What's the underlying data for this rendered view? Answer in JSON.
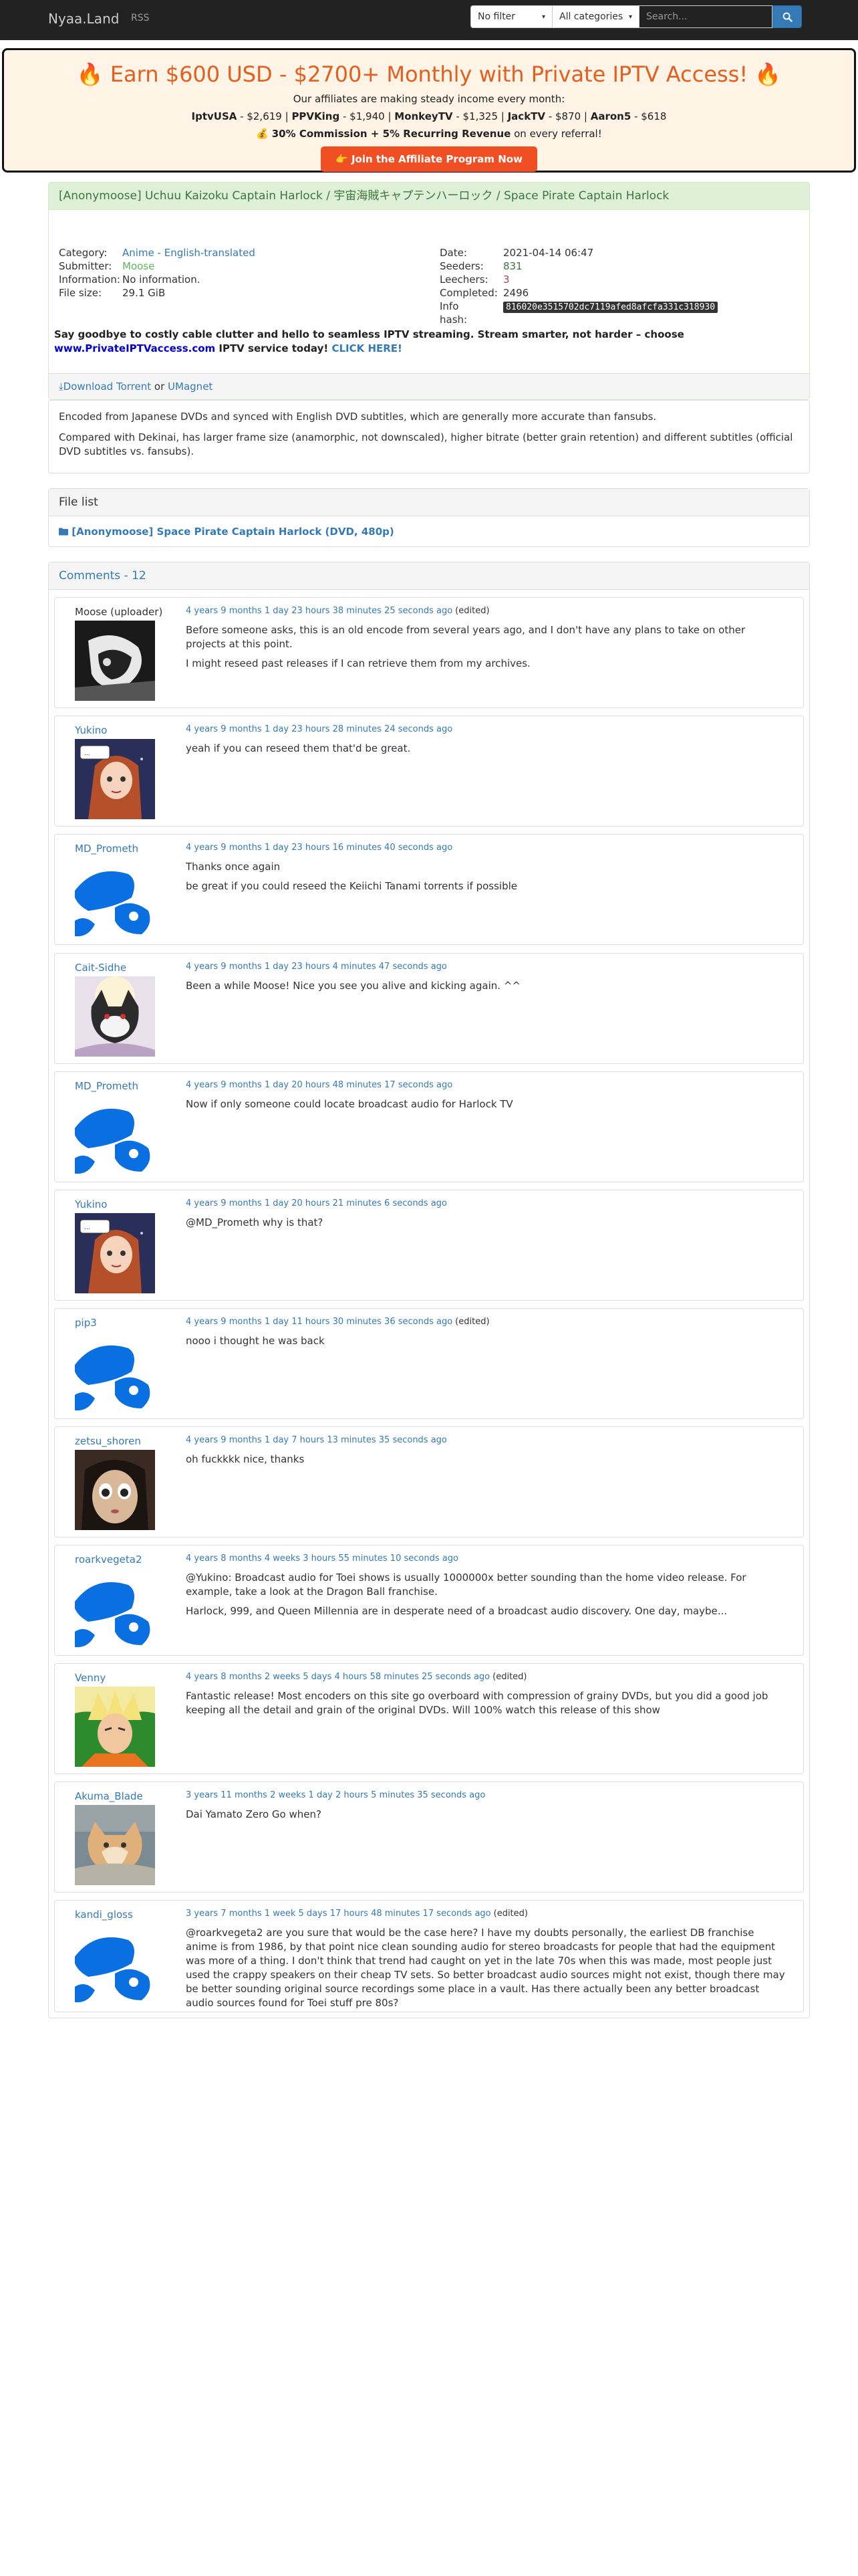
{
  "nav": {
    "brand": "Nyaa.Land",
    "rss": "RSS",
    "filter": "No filter",
    "category": "All categories",
    "search_placeholder": "Search..."
  },
  "promo": {
    "title": "🔥 Earn $600 USD - $2700+ Monthly with Private IPTV Access! 🔥",
    "subtitle": "Our affiliates are making steady income every month:",
    "earners": [
      {
        "name": "IptvUSA",
        "amount": "$2,619"
      },
      {
        "name": "PPVKing",
        "amount": "$1,940"
      },
      {
        "name": "MonkeyTV",
        "amount": "$1,325"
      },
      {
        "name": "JackTV",
        "amount": "$870"
      },
      {
        "name": "Aaron5",
        "amount": "$618"
      }
    ],
    "commission_bold": "30% Commission + 5% Recurring Revenue",
    "commission_rest": " on every referral!",
    "commission_icon": "💰",
    "button": "Join the Affiliate Program Now",
    "button_icon": "👉"
  },
  "torrent": {
    "title": "[Anonymoose] Uchuu Kaizoku Captain Harlock / 宇宙海賊キャプテンハーロック / Space Pirate Captain Harlock",
    "labels": {
      "category": "Category:",
      "submitter": "Submitter:",
      "information": "Information:",
      "file_size": "File size:",
      "date": "Date:",
      "seeders": "Seeders:",
      "leechers": "Leechers:",
      "completed": "Completed:",
      "info_hash": "Info hash:"
    },
    "category": "Anime - English-translated",
    "submitter": "Moose",
    "information": "No information.",
    "file_size": "29.1 GiB",
    "date": "2021-04-14 06:47",
    "seeders": "831",
    "leechers": "3",
    "completed": "2496",
    "info_hash": "816020e3515702dc7119afed8afcfa331c318930",
    "iptv_text": "Say goodbye to costly cable clutter and hello to seamless IPTV streaming. Stream smarter, not harder – choose ",
    "iptv_link": "www.PrivateIPTVaccess.com",
    "iptv_text2": " IPTV service today! ",
    "iptv_click": "CLICK HERE!",
    "download": "Download Torrent",
    "or": "or",
    "magnet": "Magnet"
  },
  "description": [
    "Encoded from Japanese DVDs and synced with English DVD subtitles, which are generally more accurate than fansubs.",
    "Compared with Dekinai, has larger frame size (anamorphic, not downscaled), higher bitrate (better grain retention) and different subtitles (official DVD subtitles vs. fansubs)."
  ],
  "file_list": {
    "title": "File list",
    "folder": "[Anonymoose] Space Pirate Captain Harlock (DVD, 480p)"
  },
  "comments_title": "Comments - 12",
  "comments": [
    {
      "user": "Moose (uploader)",
      "date": "4 years 9 months 1 day 23 hours 38 minutes 25 seconds ago",
      "edited": "(edited)",
      "avatar": "dark",
      "text": [
        "Before someone asks, this is an old encode from several years ago, and I don't have any plans to take on other projects at this point.",
        "I might reseed past releases if I can retrieve them from my archives."
      ]
    },
    {
      "user": "Yukino",
      "date": "4 years 9 months 1 day 23 hours 28 minutes 24 seconds ago",
      "edited": "",
      "avatar": "girl",
      "text": [
        "yeah if you can reseed them that'd be great."
      ]
    },
    {
      "user": "MD_Prometh",
      "date": "4 years 9 months 1 day 23 hours 16 minutes 40 seconds ago",
      "edited": "",
      "avatar": "default",
      "text": [
        "Thanks once again",
        "be great if you could reseed the Keiichi Tanami torrents if possible"
      ]
    },
    {
      "user": "Cait-Sidhe",
      "date": "4 years 9 months 1 day 23 hours 4 minutes 47 seconds ago",
      "edited": "",
      "avatar": "cat",
      "text": [
        "Been a while Moose! Nice you see you alive and kicking again. ^^"
      ]
    },
    {
      "user": "MD_Prometh",
      "date": "4 years 9 months 1 day 20 hours 48 minutes 17 seconds ago",
      "edited": "",
      "avatar": "default",
      "text": [
        "Now if only someone could locate broadcast audio for Harlock TV"
      ]
    },
    {
      "user": "Yukino",
      "date": "4 years 9 months 1 day 20 hours 21 minutes 6 seconds ago",
      "edited": "",
      "avatar": "girl",
      "text": [
        "@MD_Prometh why is that?"
      ]
    },
    {
      "user": "pip3",
      "date": "4 years 9 months 1 day 11 hours 30 minutes 36 seconds ago",
      "edited": "(edited)",
      "avatar": "default",
      "text": [
        "nooo i thought he was back"
      ]
    },
    {
      "user": "zetsu_shoren",
      "date": "4 years 9 months 1 day 7 hours 13 minutes 35 seconds ago",
      "edited": "",
      "avatar": "face",
      "text": [
        "oh fuckkkk nice, thanks"
      ]
    },
    {
      "user": "roarkvegeta2",
      "date": "4 years 8 months 4 weeks 3 hours 55 minutes 10 seconds ago",
      "edited": "",
      "avatar": "default",
      "text": [
        "@Yukino: Broadcast audio for Toei shows is usually 1000000x better sounding than the home video release. For example, take a look at the Dragon Ball franchise.",
        "Harlock, 999, and Queen Millennia are in desperate need of a broadcast audio discovery. One day, maybe..."
      ]
    },
    {
      "user": "Venny",
      "date": "4 years 8 months 2 weeks 5 days 4 hours 58 minutes 25 seconds ago",
      "edited": "(edited)",
      "avatar": "goku",
      "text": [
        "Fantastic release! Most encoders on this site go overboard with compression of grainy DVDs, but you did a good job keeping all the detail and grain of the original DVDs. Will 100% watch this release of this show"
      ]
    },
    {
      "user": "Akuma_Blade",
      "date": "3 years 11 months 2 weeks 1 day 2 hours 5 minutes 35 seconds ago",
      "edited": "",
      "avatar": "kitten",
      "text": [
        "Dai Yamato Zero Go when?"
      ]
    },
    {
      "user": "kandi_gloss",
      "date": "3 years 7 months 1 week 5 days 17 hours 48 minutes 17 seconds ago",
      "edited": "(edited)",
      "avatar": "default",
      "text": [
        "@roarkvegeta2 are you sure that would be the case here? I have my doubts personally, the earliest DB franchise anime is from 1986, by that point nice clean sounding audio for stereo broadcasts for people that had the equipment was more of a thing. I don't think that trend had caught on yet in the late 70s when this was made, most people just used the crappy speakers on their cheap TV sets. So better broadcast audio sources might not exist, though there may be better sounding original source recordings some place in a vault. Has there actually been any better broadcast audio sources found for Toei stuff pre 80s?"
      ]
    }
  ]
}
